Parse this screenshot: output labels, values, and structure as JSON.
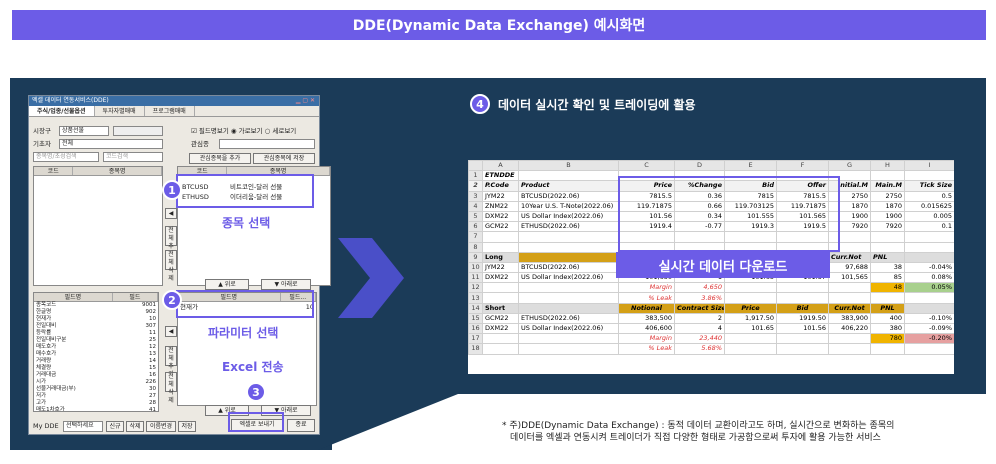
{
  "banner": {
    "title": "DDE(Dynamic Data Exchange) 예시화면"
  },
  "step4": {
    "num": "4",
    "text": "데이터 실시간 확인 및 트레이딩에 활용"
  },
  "app": {
    "title": "엑셀 데이터 연동서비스(DDE)",
    "tabs": [
      "주식/업종/선물옵션",
      "투자자별매매",
      "프로그램매매"
    ],
    "market_label": "시장구",
    "market_value": "상품선물",
    "base_label": "기초자",
    "base_value": "전체",
    "search1": "종목명/초성검색",
    "search2": "코드검색",
    "field_option": "필드명보기",
    "horizontal": "가로보기",
    "vertical": "세로보기",
    "interest_label": "관심종",
    "add_interest": "관심종목을 추가",
    "save_interest": "관심종목에 저장",
    "code_header": "코드",
    "name_header": "종목명",
    "selected": [
      {
        "code": "BTCUSD",
        "name": "비트코인-달러 선물"
      },
      {
        "code": "ETHUSD",
        "name": "이더리움-달러 선물"
      }
    ],
    "add_all": "전체추가",
    "del_all": "전체삭제",
    "up": "▲ 위로",
    "down": "▼ 아래로",
    "field_header": "필드명",
    "field_code": "필드",
    "fields": [
      [
        "종목코드",
        "9001"
      ],
      [
        "한글명",
        "902"
      ],
      [
        "현재가",
        "10"
      ],
      [
        "전일대비",
        "307"
      ],
      [
        "등락률",
        "11"
      ],
      [
        "전일대비구분",
        "25"
      ],
      [
        "매도호가",
        "12"
      ],
      [
        "매수호가",
        "13"
      ],
      [
        "거래량",
        "14"
      ],
      [
        "체결량",
        "15"
      ],
      [
        "거래대금",
        "16"
      ],
      [
        "시가",
        "226"
      ],
      [
        "선물거래대금(부)",
        "30"
      ],
      [
        "저가",
        "27"
      ],
      [
        "고가",
        "28"
      ],
      [
        "매도1차호가",
        "41"
      ],
      [
        "매수1차호가",
        "42"
      ],
      [
        "매도2차호가",
        "43"
      ],
      [
        "매수2차호가",
        "44"
      ]
    ],
    "sel_field_header": "필드명",
    "sel_field_code": "필드...",
    "sel_fields": [
      [
        "현재가",
        "10"
      ]
    ],
    "mydde": "My DDE",
    "mydde_value": "선택하세요",
    "btm_buttons": [
      "신규",
      "삭제",
      "이름변경",
      "저장"
    ],
    "export": "엑셀로 보내기",
    "close": "종료"
  },
  "annotations": {
    "b1": "1",
    "b2": "2",
    "b3": "3",
    "stock_select": "종목 선택",
    "param_select": "파라미터 선택",
    "excel_send": "Excel 전송"
  },
  "excel": {
    "cols": [
      "A",
      "B",
      "C",
      "D",
      "E",
      "F",
      "G",
      "H",
      "I"
    ],
    "rows": [
      [
        "1",
        "ETNDDE",
        "",
        "",
        "",
        "",
        "",
        "",
        ""
      ],
      [
        "2",
        "P.Code",
        "Product",
        "Price",
        "%Change",
        "Bid",
        "Offer",
        "Initial.M",
        "Main.M",
        "Tick Size"
      ],
      [
        "3",
        "JYM22",
        "BTCUSD(2022.06)",
        "7815.5",
        "0.36",
        "7815",
        "7815.5",
        "2750",
        "2750",
        "0.5"
      ],
      [
        "4",
        "ZNM22",
        "10Year U.S. T-Note(2022.06)",
        "119.71875",
        "0.66",
        "119.703125",
        "119.71875",
        "1870",
        "1870",
        "0.015625"
      ],
      [
        "5",
        "DXM22",
        "US Dollar Index(2022.06)",
        "101.56",
        "0.34",
        "101.555",
        "101.565",
        "1900",
        "1900",
        "0.005"
      ],
      [
        "6",
        "GCM22",
        "ETHUSD(2022.06)",
        "1919.4",
        "-0.77",
        "1919.3",
        "1919.5",
        "7920",
        "7920",
        "0.1"
      ]
    ],
    "long_label": "Long",
    "short_label": "Short",
    "long_rows": [
      [
        "10",
        "JYM22",
        "BTCUSD(2022.06)",
        "",
        "",
        "",
        "",
        "97,688",
        "38",
        "-0.04%"
      ],
      [
        "11",
        "DXM22",
        "US Dollar Index(2022.06)",
        "101,650",
        "1",
        "101.65",
        "101.57",
        "101,565",
        "85",
        "0.08%"
      ]
    ],
    "margin": "Margin",
    "leak": "% Leak",
    "long_margin": "4,650",
    "long_leak": "3.86%",
    "long_margin_val": "48",
    "long_margin_pct": "0.05%",
    "short_head": [
      "Notional",
      "Contract Size",
      "Price",
      "Bid",
      "Curr.Not",
      "PNL"
    ],
    "curr_not": "Curr.Not",
    "pnl": "PNL",
    "short_rows": [
      [
        "15",
        "GCM22",
        "ETHUSD(2022.06)",
        "383,500",
        "2",
        "1,917.50",
        "1919.50",
        "383,900",
        "400",
        "-0.10%"
      ],
      [
        "16",
        "DXM22",
        "US Dollar Index(2022.06)",
        "406,600",
        "4",
        "101.65",
        "101.56",
        "406,220",
        "380",
        "-0.09%"
      ]
    ],
    "short_margin": "23,440",
    "short_leak": "5.68%",
    "short_margin_val": "780",
    "short_margin_pct": "-0.20%",
    "download": "실시간 데이터 다운로드"
  },
  "footnote": {
    "line1": "* 주)DDE(Dynamic Data Exchange) : 동적 데이터 교환이라고도 하며, 실시간으로 변화하는 종목의",
    "line2": "데이터를 엑셀과 연동시켜 트레이더가 직접 다양한 형태로 가공함으로써 투자에 활용 가능한 서비스"
  },
  "colors": {
    "accent": "#6c5ce7",
    "panel": "#1b3b58"
  }
}
